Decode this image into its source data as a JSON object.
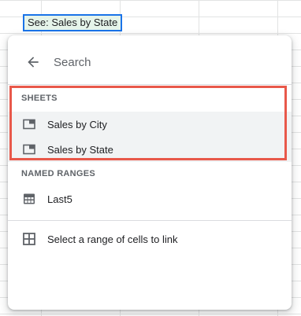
{
  "cell": {
    "chip_text": "See: Sales by State"
  },
  "popup": {
    "search": {
      "placeholder": "Search",
      "back_icon": "arrow-left-icon"
    },
    "sheets": {
      "header": "SHEETS",
      "items": [
        {
          "label": "Sales by City",
          "icon": "sheet-tab-icon"
        },
        {
          "label": "Sales by State",
          "icon": "sheet-tab-icon"
        }
      ]
    },
    "named_ranges": {
      "header": "NAMED RANGES",
      "items": [
        {
          "label": "Last5",
          "icon": "table-grid-icon"
        }
      ]
    },
    "select_range": {
      "label": "Select a range of cells to link",
      "icon": "grid-select-icon"
    }
  },
  "colors": {
    "highlight_border": "#e8584a",
    "chip_border": "#1a73e8",
    "chip_background": "#e6f4ea"
  }
}
